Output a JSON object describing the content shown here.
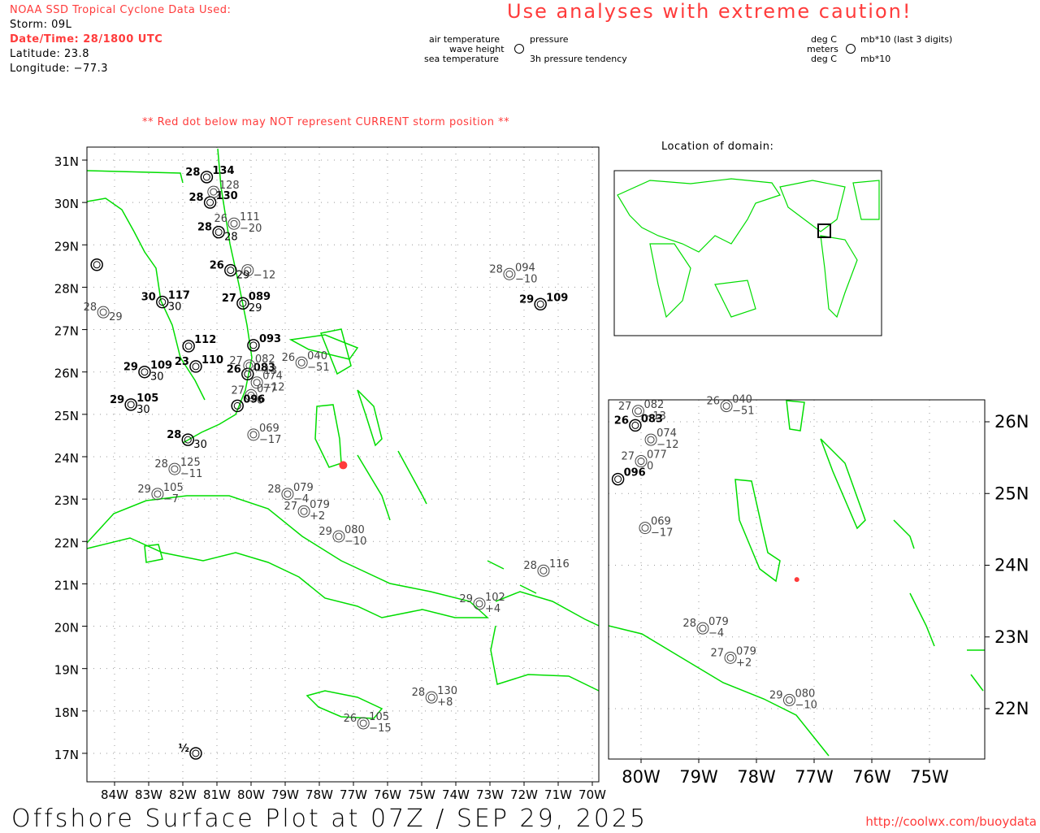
{
  "header": {
    "source": "NOAA SSD Tropical Cyclone Data Used:",
    "storm": "Storm: 09L",
    "datetime": "Date/Time: 28/1800 UTC",
    "latitude": "Latitude: 23.8",
    "longitude": "Longitude: −77.3",
    "caution": "Use analyses with extreme caution!",
    "red_dot_note": "** Red dot below may NOT represent CURRENT storm position **",
    "domain_label": "Location of domain:"
  },
  "legend": {
    "air_temp": "air temperature",
    "pressure": "pressure",
    "wave_height": "wave height",
    "sea_temp": "sea temperature",
    "tendency": "3h pressure tendency",
    "deg_c_1": "deg C",
    "mb_last3": "mb*10 (last 3 digits)",
    "meters": "meters",
    "deg_c_2": "deg C",
    "mb10": "mb*10"
  },
  "main_map": {
    "lon_labels": [
      "84W",
      "83W",
      "82W",
      "81W",
      "80W",
      "79W",
      "78W",
      "77W",
      "76W",
      "75W",
      "74W",
      "73W",
      "72W",
      "71W",
      "70W"
    ],
    "lat_labels": [
      "31N",
      "30N",
      "29N",
      "28N",
      "27N",
      "26N",
      "25N",
      "24N",
      "23N",
      "22N",
      "21N",
      "20N",
      "19N",
      "18N",
      "17N"
    ]
  },
  "inset_map": {
    "lon_labels": [
      "80W",
      "79W",
      "78W",
      "77W",
      "76W",
      "75W"
    ],
    "lat_labels": [
      "26N",
      "25N",
      "24N",
      "23N",
      "22N"
    ]
  },
  "storm": {
    "lat": 23.8,
    "lon": -77.3,
    "color": "#ff3b3b"
  },
  "colors": {
    "coast": "#00dd00",
    "grid": "#999999",
    "accent": "#ff3b3b"
  },
  "stations": [
    {
      "lat": 28.31,
      "lon": -72.43,
      "air": "28",
      "pres": "094",
      "tend": "−10",
      "dark": false
    },
    {
      "lat": 27.6,
      "lon": -71.52,
      "air": "29",
      "pres": "109",
      "tend": "",
      "dark": true
    },
    {
      "lat": 26.22,
      "lon": -78.52,
      "air": "26",
      "pres": "040",
      "tend": "−51",
      "dark": false
    },
    {
      "lat": 24.52,
      "lon": -79.93,
      "air": "",
      "pres": "069",
      "tend": "−17",
      "dark": false
    },
    {
      "lat": 23.71,
      "lon": -82.24,
      "air": "28",
      "pres": "125",
      "tend": "−11",
      "dark": false
    },
    {
      "lat": 23.12,
      "lon": -82.74,
      "air": "29",
      "pres": "105",
      "tend": "−7",
      "dark": false
    },
    {
      "lat": 23.12,
      "lon": -78.93,
      "air": "28",
      "pres": "079",
      "tend": "−4",
      "dark": false
    },
    {
      "lat": 22.71,
      "lon": -78.45,
      "air": "27",
      "pres": "079",
      "tend": "+2",
      "dark": false
    },
    {
      "lat": 22.12,
      "lon": -77.43,
      "air": "29",
      "pres": "080",
      "tend": "−10",
      "dark": false
    },
    {
      "lat": 21.31,
      "lon": -71.43,
      "air": "28",
      "pres": "116",
      "tend": "",
      "dark": false
    },
    {
      "lat": 20.53,
      "lon": -73.31,
      "air": "29",
      "pres": "102",
      "tend": "+4",
      "dark": false
    },
    {
      "lat": 18.32,
      "lon": -74.71,
      "air": "28",
      "pres": "130",
      "tend": "+8",
      "dark": false
    },
    {
      "lat": 17.71,
      "lon": -76.71,
      "air": "26",
      "pres": "105",
      "tend": "−15",
      "dark": false
    },
    {
      "lat": 17.0,
      "lon": -81.62,
      "air": "½",
      "pres": "",
      "tend": "",
      "dark": true
    },
    {
      "lat": 27.41,
      "lon": -84.33,
      "air": "28",
      "pres": "",
      "tend": "29",
      "dark": false
    },
    {
      "lat": 28.53,
      "lon": -84.52,
      "air": "",
      "pres": "",
      "tend": "",
      "dark": true
    },
    {
      "lat": 27.62,
      "lon": -80.24,
      "air": "27",
      "pres": "089",
      "tend": "29",
      "dark": true
    },
    {
      "lat": 26.63,
      "lon": -79.93,
      "air": "",
      "pres": "093",
      "tend": "",
      "dark": true
    },
    {
      "lat": 26.61,
      "lon": -81.83,
      "air": "",
      "pres": "112",
      "tend": "",
      "dark": true
    },
    {
      "lat": 26.13,
      "lon": -81.62,
      "air": "23",
      "pres": "110",
      "tend": "",
      "dark": true
    },
    {
      "lat": 26.0,
      "lon": -83.12,
      "air": "29",
      "pres": "109",
      "tend": "30",
      "dark": true
    },
    {
      "lat": 25.23,
      "lon": -83.52,
      "air": "29",
      "pres": "105",
      "tend": "30",
      "dark": true
    },
    {
      "lat": 25.95,
      "lon": -80.1,
      "air": "26",
      "pres": "083",
      "tend": "",
      "dark": true
    },
    {
      "lat": 25.75,
      "lon": -79.83,
      "air": "",
      "pres": "074",
      "tend": "−12",
      "dark": false
    },
    {
      "lat": 25.45,
      "lon": -80.0,
      "air": "27",
      "pres": "077",
      "tend": "0",
      "dark": false
    },
    {
      "lat": 26.15,
      "lon": -80.05,
      "air": "27",
      "pres": "082",
      "tend": "−13",
      "dark": false
    },
    {
      "lat": 25.2,
      "lon": -80.4,
      "air": "",
      "pres": "096",
      "tend": "",
      "dark": true
    },
    {
      "lat": 24.4,
      "lon": -81.85,
      "air": "28",
      "pres": "",
      "tend": "30",
      "dark": true
    },
    {
      "lat": 29.3,
      "lon": -80.95,
      "air": "28",
      "pres": "",
      "tend": "28",
      "dark": true
    },
    {
      "lat": 30.0,
      "lon": -81.2,
      "air": "28",
      "pres": "130",
      "tend": "",
      "dark": true
    },
    {
      "lat": 30.25,
      "lon": -81.1,
      "air": "",
      "pres": "128",
      "tend": "",
      "dark": false
    },
    {
      "lat": 30.6,
      "lon": -81.3,
      "air": "28",
      "pres": "134",
      "tend": "",
      "dark": true
    },
    {
      "lat": 29.5,
      "lon": -80.5,
      "air": "26",
      "pres": "111",
      "tend": "−20",
      "dark": false
    },
    {
      "lat": 28.4,
      "lon": -80.6,
      "air": "26",
      "pres": "",
      "tend": "29",
      "dark": true
    },
    {
      "lat": 28.4,
      "lon": -80.1,
      "air": "",
      "pres": "",
      "tend": "−12",
      "dark": false
    },
    {
      "lat": 27.65,
      "lon": -82.6,
      "air": "30",
      "pres": "117",
      "tend": "30",
      "dark": true
    }
  ],
  "footer": {
    "title": "Offshore Surface Plot at 07Z / SEP 29, 2025",
    "url": "http://coolwx.com/buoydata"
  }
}
